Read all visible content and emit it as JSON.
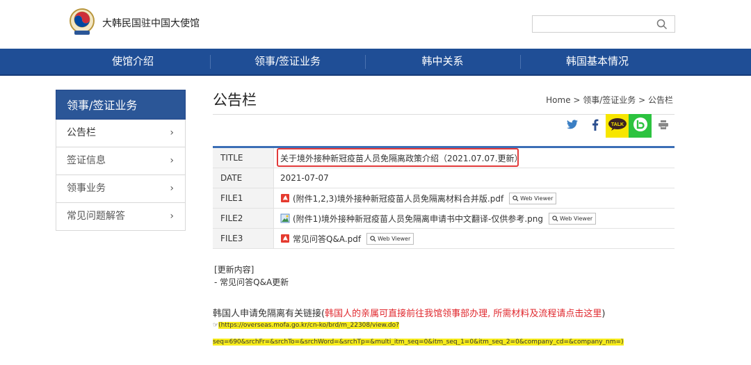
{
  "header": {
    "site_title": "大韩民国驻中国大使馆"
  },
  "nav": {
    "items": [
      "使馆介绍",
      "领事/签证业务",
      "韩中关系",
      "韩国基本情况"
    ]
  },
  "sidebar": {
    "title": "领事/签证业务",
    "items": [
      {
        "label": "公告栏",
        "active": true
      },
      {
        "label": "签证信息"
      },
      {
        "label": "领事业务"
      },
      {
        "label": "常见问题解答"
      }
    ],
    "chevron": "›"
  },
  "main": {
    "page_title": "公告栏",
    "breadcrumb": "Home > 领事/签证业务 > 公告栏",
    "share_icons": [
      "twitter-icon",
      "facebook-icon",
      "kakaotalk-icon",
      "band-icon",
      "print-icon"
    ],
    "table": {
      "title_label": "TITLE",
      "title_value": "关于境外接种新冠疫苗人员免隔离政策介绍（2021.07.07.更新）",
      "date_label": "DATE",
      "date_value": "2021-07-07",
      "files": [
        {
          "label": "FILE1",
          "name": "(附件1,2,3)境外接种新冠疫苗人员免隔离材料合并版.pdf",
          "type": "pdf"
        },
        {
          "label": "FILE2",
          "name": "(附件1)境外接种新冠疫苗人员免隔离申请书中文翻译-仅供参考.png",
          "type": "image"
        },
        {
          "label": "FILE3",
          "name": "常见问答Q&A.pdf",
          "type": "pdf"
        }
      ],
      "viewer_label": "Web Viewer"
    },
    "update_heading": "[更新内容]",
    "update_item": "- 常见问答Q&A更新",
    "link_intro": "韩国人申请免隔离有关链接(",
    "link_red": "韩国人的亲属可直接前往我馆领事部办理, 所需材料及流程请点击这里",
    "link_close": ")",
    "url_arrow": "☞",
    "url_line1": "(https://overseas.mofa.go.kr/cn-ko/brd/m_22308/view.do?",
    "url_line2": "seq=690&srchFr=&srchTo=&srchWord=&srchTp=&multi_itm_seq=0&itm_seq_1=0&itm_seq_2=0&company_cd=&company_nm=)"
  },
  "colors": {
    "nav_bg": "#1f4e96",
    "sidebar_title_bg": "#2b5697",
    "table_top": "#3b6eb6",
    "highlight_border": "#e23a3a",
    "link_red": "#e0282e",
    "url_highlight": "#f7ec1a"
  }
}
